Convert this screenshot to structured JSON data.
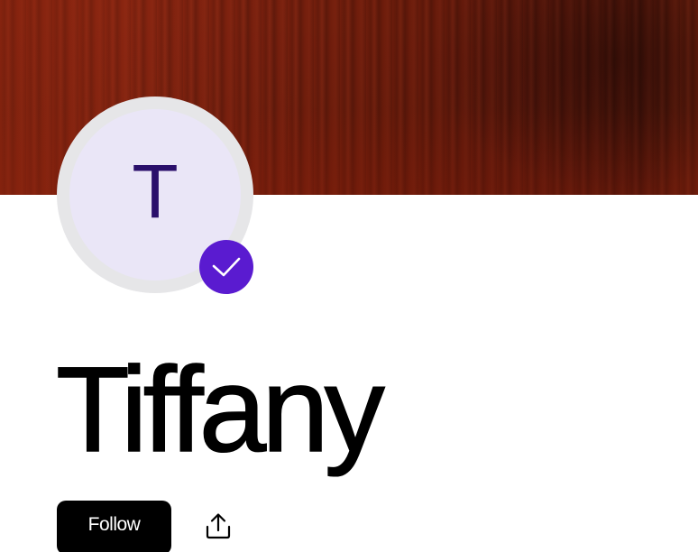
{
  "profile": {
    "avatar_initial": "T",
    "name": "Tiffany",
    "verified": true
  },
  "actions": {
    "follow_label": "Follow",
    "share_icon": "share-upload-icon"
  },
  "colors": {
    "banner": "#7a200e",
    "avatar_bg": "#eae6f7",
    "avatar_text": "#2a0f6b",
    "avatar_ring": "#e6e6e8",
    "badge": "#5a1bd0",
    "button_bg": "#000000",
    "button_text": "#ffffff"
  },
  "icons": {
    "banner": "red-curtain-banner",
    "badge": "checkmark-icon"
  }
}
